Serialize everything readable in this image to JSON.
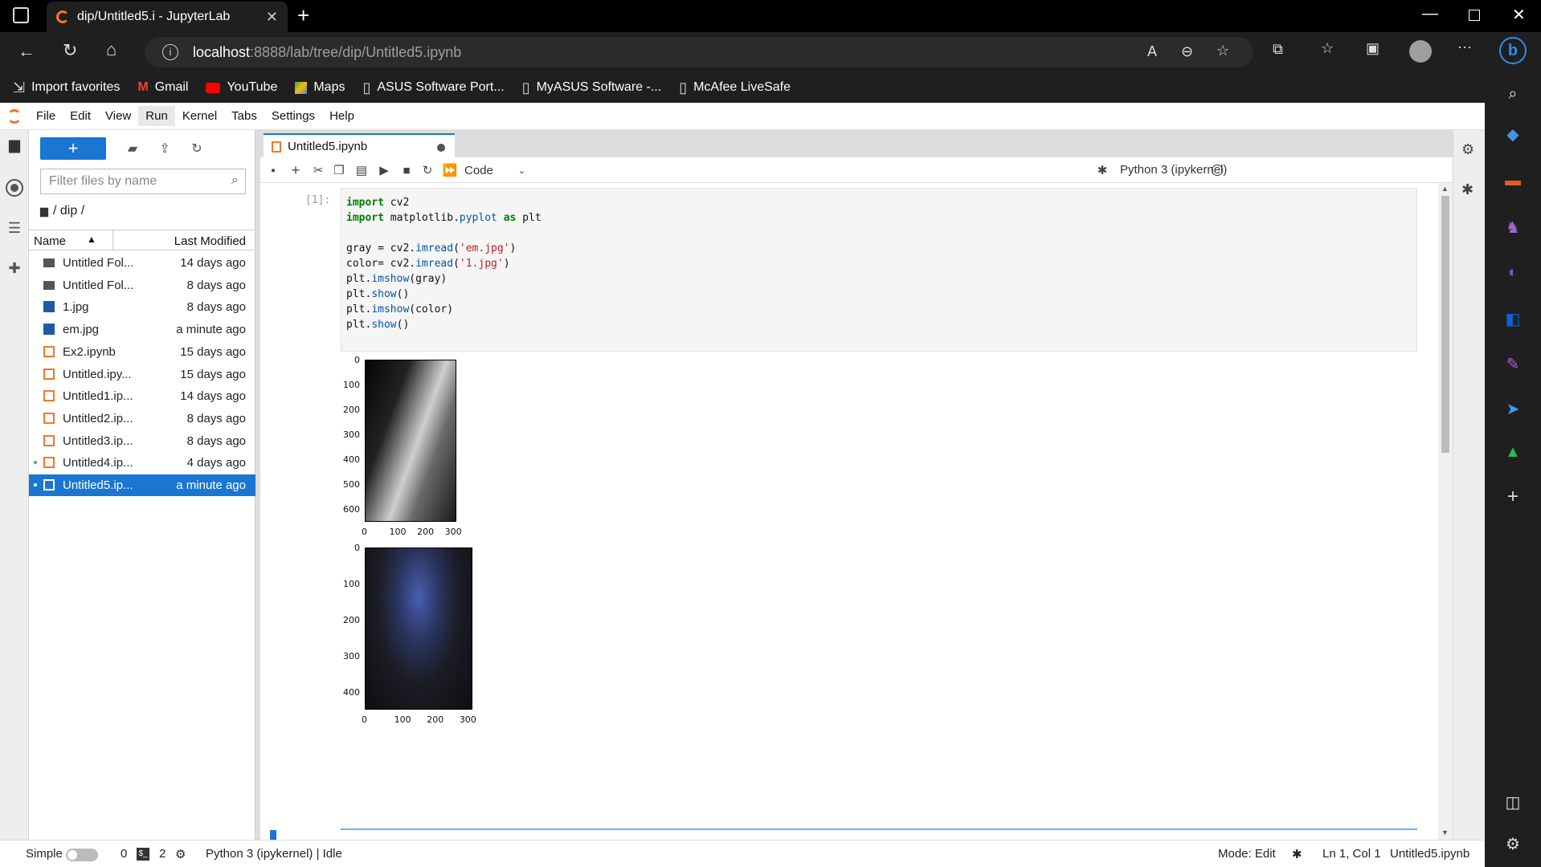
{
  "browser": {
    "tab_title": "dip/Untitled5.i - JupyterLab",
    "url_host": "localhost",
    "url_rest": ":8888/lab/tree/dip/Untitled5.ipynb",
    "favorites": [
      "Import favorites",
      "Gmail",
      "YouTube",
      "Maps",
      "ASUS Software Port...",
      "MyASUS Software -...",
      "McAfee LiveSafe"
    ]
  },
  "menu": [
    "File",
    "Edit",
    "View",
    "Run",
    "Kernel",
    "Tabs",
    "Settings",
    "Help"
  ],
  "menu_active": "Run",
  "filebrowser": {
    "new_label": "+",
    "filter_placeholder": "Filter files by name",
    "breadcrumb": "/ dip /",
    "col_name": "Name",
    "col_modified": "Last Modified",
    "files": [
      {
        "name": "Untitled Fol...",
        "modified": "14 days ago",
        "kind": "folder"
      },
      {
        "name": "Untitled Fol...",
        "modified": "8 days ago",
        "kind": "folder"
      },
      {
        "name": "1.jpg",
        "modified": "8 days ago",
        "kind": "image"
      },
      {
        "name": "em.jpg",
        "modified": "a minute ago",
        "kind": "image"
      },
      {
        "name": "Ex2.ipynb",
        "modified": "15 days ago",
        "kind": "notebook"
      },
      {
        "name": "Untitled.ipy...",
        "modified": "15 days ago",
        "kind": "notebook"
      },
      {
        "name": "Untitled1.ip...",
        "modified": "14 days ago",
        "kind": "notebook"
      },
      {
        "name": "Untitled2.ip...",
        "modified": "8 days ago",
        "kind": "notebook"
      },
      {
        "name": "Untitled3.ip...",
        "modified": "8 days ago",
        "kind": "notebook"
      },
      {
        "name": "Untitled4.ip...",
        "modified": "4 days ago",
        "kind": "notebook",
        "running": true
      },
      {
        "name": "Untitled5.ip...",
        "modified": "a minute ago",
        "kind": "notebook",
        "running": true,
        "selected": true
      }
    ]
  },
  "notebook": {
    "tab_label": "Untitled5.ipynb",
    "cell_type": "Code",
    "kernel_name": "Python 3 (ipykernel)",
    "prompt": "[1]:",
    "code_lines": [
      "import cv2",
      "import matplotlib.pyplot as plt",
      "",
      "gray = cv2.imread('em.jpg')",
      "color= cv2.imread('1.jpg')",
      "plt.imshow(gray)",
      "plt.show()",
      "plt.imshow(color)",
      "plt.show()"
    ],
    "fig1": {
      "yticks": [
        "0",
        "100",
        "200",
        "300",
        "400",
        "500",
        "600"
      ],
      "xticks": [
        "0",
        "100",
        "200",
        "300"
      ]
    },
    "fig2": {
      "yticks": [
        "0",
        "100",
        "200",
        "300",
        "400"
      ],
      "xticks": [
        "0",
        "100",
        "200",
        "300"
      ]
    }
  },
  "status": {
    "mode_label": "Simple",
    "terminals": "0",
    "kernels": "2",
    "kernel_status": "Python 3 (ipykernel) | Idle",
    "mode": "Mode: Edit",
    "cursor": "Ln 1, Col 1",
    "file": "Untitled5.ipynb"
  },
  "colors": {
    "accent": "#1976d2",
    "jupyter_orange": "#f37726"
  }
}
